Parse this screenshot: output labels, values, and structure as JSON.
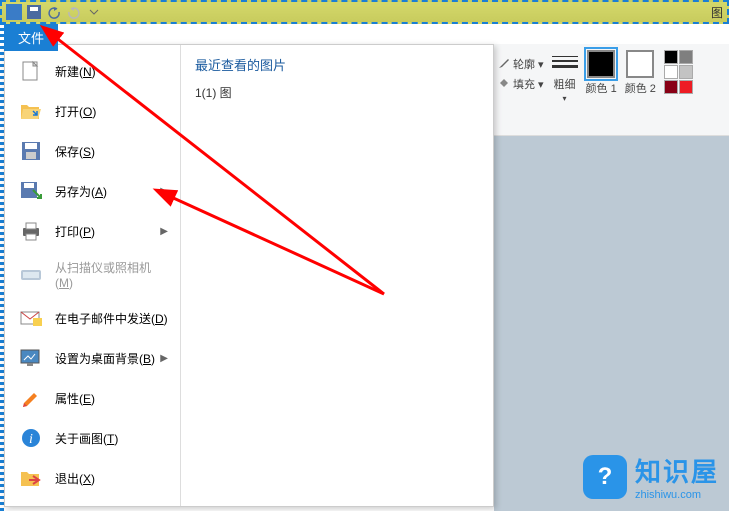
{
  "titlebar": {
    "title_char": "图"
  },
  "file_tab": {
    "label": "文件"
  },
  "menu": {
    "items": [
      {
        "label": "新建(N)",
        "icon": "new-doc-icon"
      },
      {
        "label": "打开(O)",
        "icon": "open-folder-icon"
      },
      {
        "label": "保存(S)",
        "icon": "save-icon"
      },
      {
        "label": "另存为(A)",
        "icon": "save-as-icon",
        "has_submenu": true
      },
      {
        "label": "打印(P)",
        "icon": "print-icon",
        "has_submenu": true
      },
      {
        "label": "从扫描仪或照相机(M)",
        "icon": "scanner-icon",
        "disabled": true
      },
      {
        "label": "在电子邮件中发送(D)",
        "icon": "email-icon"
      },
      {
        "label": "设置为桌面背景(B)",
        "icon": "desktop-bg-icon",
        "has_submenu": true
      },
      {
        "label": "属性(E)",
        "icon": "properties-icon"
      },
      {
        "label": "关于画图(T)",
        "icon": "about-icon"
      },
      {
        "label": "退出(X)",
        "icon": "exit-icon"
      }
    ]
  },
  "recent": {
    "title": "最近查看的图片",
    "items": [
      "1(1) 图"
    ]
  },
  "ribbon": {
    "outline": "轮廓",
    "fill": "填充",
    "thickness": "粗细",
    "color1": "颜色 1",
    "color2": "颜色 2",
    "palette": [
      "#000000",
      "#7f7f7f",
      "#ffffff",
      "#c3c3c3",
      "#880015",
      "#ed1c24"
    ]
  },
  "watermark": {
    "badge": "?",
    "cn": "知识屋",
    "en": "zhishiwu.com"
  }
}
